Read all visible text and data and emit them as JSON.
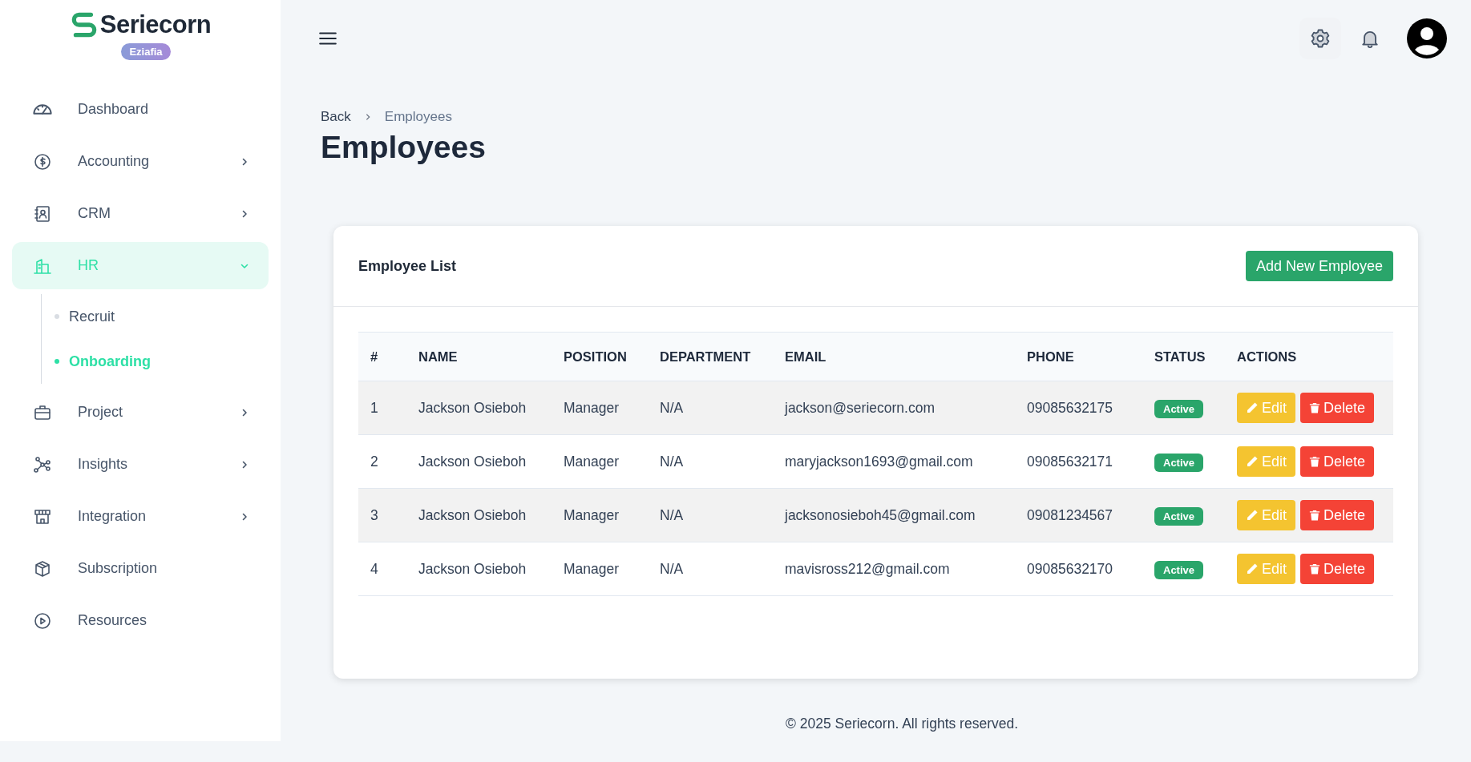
{
  "brand": {
    "name": "Seriecorn",
    "badge": "Eziafia"
  },
  "sidebar": {
    "items": [
      {
        "label": "Dashboard",
        "selected": false,
        "has_submenu": false
      },
      {
        "label": "Accounting",
        "selected": false,
        "has_submenu": true,
        "expanded": false
      },
      {
        "label": "CRM",
        "selected": false,
        "has_submenu": true,
        "expanded": false
      },
      {
        "label": "HR",
        "selected": true,
        "has_submenu": true,
        "expanded": true,
        "children": [
          {
            "label": "Recruit",
            "selected": false
          },
          {
            "label": "Onboarding",
            "selected": true
          }
        ]
      },
      {
        "label": "Project",
        "selected": false,
        "has_submenu": true,
        "expanded": false
      },
      {
        "label": "Insights",
        "selected": false,
        "has_submenu": true,
        "expanded": false
      },
      {
        "label": "Integration",
        "selected": false,
        "has_submenu": true,
        "expanded": false
      },
      {
        "label": "Subscription",
        "selected": false,
        "has_submenu": false
      },
      {
        "label": "Resources",
        "selected": false,
        "has_submenu": false
      }
    ]
  },
  "breadcrumb": [
    "Back",
    "Employees"
  ],
  "page_title": "Employees",
  "card": {
    "title": "Employee List",
    "add_button": "Add New Employee",
    "table": {
      "columns": [
        "#",
        "NAME",
        "POSITION",
        "DEPARTMENT",
        "EMAIL",
        "PHONE",
        "STATUS",
        "ACTIONS"
      ],
      "rows": [
        {
          "index": "1",
          "name": "Jackson Osieboh",
          "position": "Manager",
          "department": "N/A",
          "email": "jackson@seriecorn.com",
          "phone": "09085632175",
          "status": "Active",
          "edit": "Edit",
          "delete": "Delete"
        },
        {
          "index": "2",
          "name": "Jackson Osieboh",
          "position": "Manager",
          "department": "N/A",
          "email": "maryjackson1693@gmail.com",
          "phone": "09085632171",
          "status": "Active",
          "edit": "Edit",
          "delete": "Delete"
        },
        {
          "index": "3",
          "name": "Jackson Osieboh",
          "position": "Manager",
          "department": "N/A",
          "email": "jacksonosieboh45@gmail.com",
          "phone": "09081234567",
          "status": "Active",
          "edit": "Edit",
          "delete": "Delete"
        },
        {
          "index": "4",
          "name": "Jackson Osieboh",
          "position": "Manager",
          "department": "N/A",
          "email": "mavisross212@gmail.com",
          "phone": "09085632170",
          "status": "Active",
          "edit": "Edit",
          "delete": "Delete"
        }
      ]
    }
  },
  "footer": "© 2025 Seriecorn. All rights reserved."
}
